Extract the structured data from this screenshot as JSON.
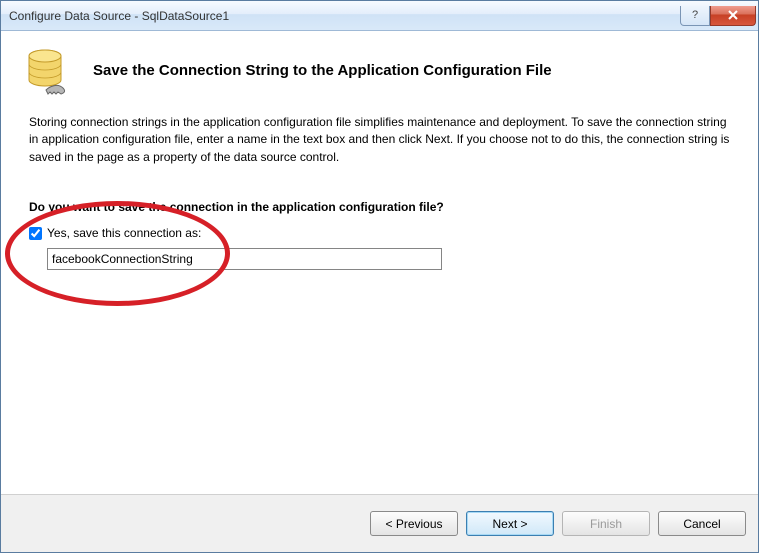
{
  "window": {
    "title": "Configure Data Source - SqlDataSource1"
  },
  "header": {
    "heading": "Save the Connection String to the Application Configuration File"
  },
  "body": {
    "description": "Storing connection strings in the application configuration file simplifies maintenance and deployment. To save the connection string in application configuration file, enter a name in the text box and then click Next. If you choose not to do this, the connection string is saved in the page as a property of the data source control.",
    "question": "Do you want to save the connection in the application configuration file?",
    "checkbox_label": "Yes, save this connection as:",
    "checkbox_checked": true,
    "input_value": "facebookConnectionString"
  },
  "footer": {
    "previous": "< Previous",
    "next": "Next >",
    "finish": "Finish",
    "cancel": "Cancel"
  }
}
